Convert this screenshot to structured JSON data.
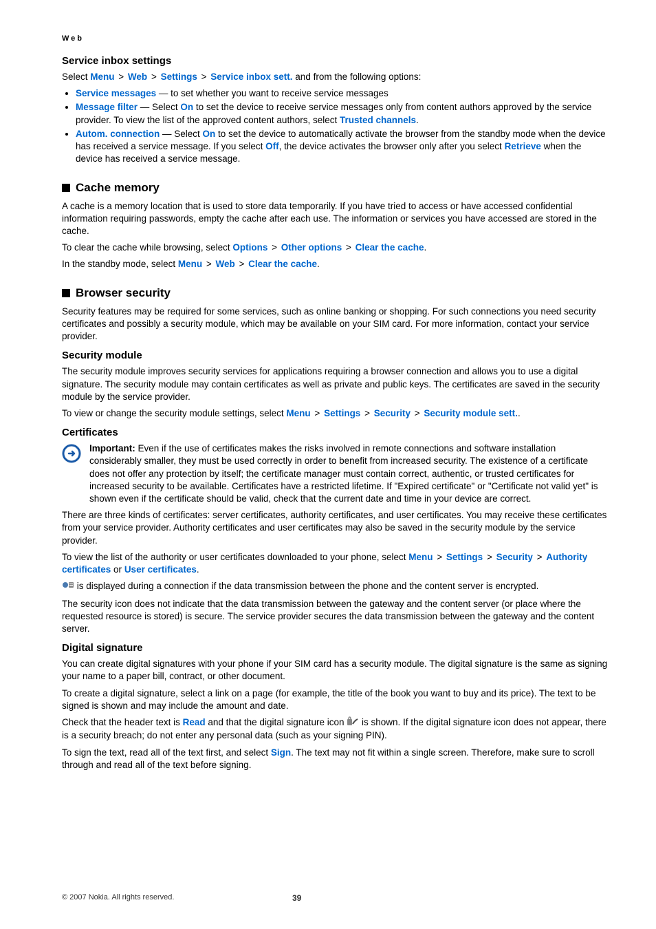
{
  "running_head": "Web",
  "service_inbox": {
    "title": "Service inbox settings",
    "intro_pre": "Select ",
    "intro_path": [
      "Menu",
      "Web",
      "Settings",
      "Service inbox sett."
    ],
    "intro_post": " and from the following options:",
    "bullets": {
      "b1_label": "Service messages",
      "b1_text": " — to set whether you want to receive service messages",
      "b2_label": "Message filter",
      "b2_seg1": " —  Select ",
      "b2_on": "On",
      "b2_seg2": " to set the device to receive service messages only from content authors approved by the service provider. To view the list of the approved content authors, select ",
      "b2_trusted": "Trusted channels",
      "b3_label": "Autom. connection",
      "b3_seg1": " — Select ",
      "b3_on": "On",
      "b3_seg2": " to set the device to automatically activate the browser from the standby mode when the device has received a service message. If you select ",
      "b3_off": "Off",
      "b3_seg3": ", the device activates the browser only after you select ",
      "b3_retrieve": "Retrieve",
      "b3_seg4": " when the device has received a service message."
    }
  },
  "cache": {
    "title": "Cache memory",
    "p1": "A cache is a memory location that is used to store data temporarily. If you have tried to access or have accessed confidential information requiring passwords, empty the cache after each use. The information or services you have accessed are stored in the cache.",
    "p2_pre": "To clear the cache while browsing, select ",
    "p2_path": [
      "Options",
      "Other options",
      "Clear the cache"
    ],
    "p3_pre": "In the standby mode, select ",
    "p3_path": [
      "Menu",
      "Web",
      "Clear the cache"
    ]
  },
  "browser_sec": {
    "title": "Browser security",
    "p1": "Security features may be required for some services, such as online banking or shopping. For such connections you need security certificates and possibly a security module, which may be available on your SIM card. For more information, contact your service provider."
  },
  "sec_module": {
    "title": "Security module",
    "p1": "The security module improves security services for applications requiring a browser connection and allows you to use a digital signature. The security module may contain certificates as well as private and public keys. The certificates are saved in the security module by the service provider.",
    "p2_pre": "To view or change the security module settings, select ",
    "p2_path": [
      "Menu",
      "Settings",
      "Security",
      "Security module sett."
    ],
    "p2_post": "."
  },
  "certs": {
    "title": "Certificates",
    "important_label": "Important:  ",
    "important": "Even if the use of certificates makes the risks involved in remote connections and software installation considerably smaller, they must be used correctly in order to benefit from increased security. The existence of a certificate does not offer any protection by itself; the certificate manager must contain correct, authentic, or trusted certificates for increased security to be available. Certificates have a restricted lifetime. If \"Expired certificate\" or \"Certificate not valid yet\" is shown even if the certificate should be valid, check that the current date and time in your device are correct.",
    "p2": "There are three kinds of certificates: server certificates, authority certificates, and user certificates. You may receive these certificates from your service provider. Authority certificates and user certificates may also be saved in the security module by the service provider.",
    "p3_pre": "To view the list of the authority or user certificates downloaded to your phone, select ",
    "p3_path": [
      "Menu",
      "Settings",
      "Security"
    ],
    "p3_auth": "Authority certificates",
    "p3_or": " or ",
    "p3_user": "User certificates",
    "p4": " is displayed during a connection if the data transmission between the phone and the content server is encrypted.",
    "p5": "The security icon does not indicate that the data transmission between the gateway and the content server (or place where the requested resource is stored) is secure. The service provider secures the data transmission between the gateway and the content server."
  },
  "digsig": {
    "title": "Digital signature",
    "p1": "You can create digital signatures with your phone if your SIM card has a security module. The digital signature is the same as signing your name to a paper bill, contract, or other document.",
    "p2": "To create a digital signature, select a link on a page (for example, the title of the book you want to buy and its price). The text to be signed is shown and may include the amount and date.",
    "p3_pre": "Check that the header text is ",
    "p3_read": "Read",
    "p3_mid": " and that the digital signature icon ",
    "p3_post": " is shown. If the digital signature icon does not appear, there is a security breach; do not enter any personal data (such as your signing PIN).",
    "p4_pre": "To sign the text, read all of the text first, and select ",
    "p4_sign": "Sign",
    "p4_post": ". The text may not fit within a single screen. Therefore, make sure to scroll through and read all of the text before signing."
  },
  "footer": {
    "copyright": "© 2007 Nokia. All rights reserved.",
    "page": "39"
  }
}
